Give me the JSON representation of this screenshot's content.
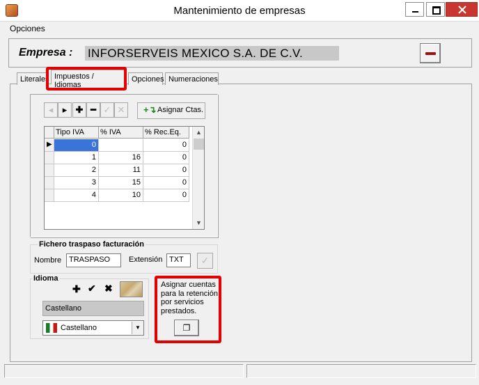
{
  "window": {
    "title": "Mantenimiento de empresas"
  },
  "menu": {
    "items": [
      "Opciones"
    ]
  },
  "empresa": {
    "label": "Empresa :",
    "value": "INFORSERVEIS MEXICO S.A. DE C.V."
  },
  "tabs": [
    {
      "label": "Literales"
    },
    {
      "label": "Impuestos / Idiomas",
      "active": true
    },
    {
      "label": "Opciones"
    },
    {
      "label": "Numeraciones"
    }
  ],
  "toolbar": {
    "assign_label": "Asignar Ctas."
  },
  "iva_grid": {
    "columns": [
      "Tipo IVA",
      "% IVA",
      "% Rec.Eq."
    ],
    "rows": [
      {
        "tipo": "0",
        "iva": "",
        "rec": "0"
      },
      {
        "tipo": "1",
        "iva": "16",
        "rec": "0"
      },
      {
        "tipo": "2",
        "iva": "11",
        "rec": "0"
      },
      {
        "tipo": "3",
        "iva": "15",
        "rec": "0"
      },
      {
        "tipo": "4",
        "iva": "10",
        "rec": "0"
      }
    ]
  },
  "fichero": {
    "title": "Fichero traspaso facturación",
    "nombre_label": "Nombre",
    "nombre_value": "TRASPASO",
    "extension_label": "Extensión",
    "extension_value": "TXT"
  },
  "idioma": {
    "title": "Idioma",
    "current": "Castellano",
    "selected": "Castellano"
  },
  "retencion": {
    "text": "Asignar cuentas para la retención por servicios prestados."
  },
  "colors": {
    "highlight": "#e20000",
    "remove_icon": "#a10f0f",
    "close_button": "#c7372f"
  }
}
